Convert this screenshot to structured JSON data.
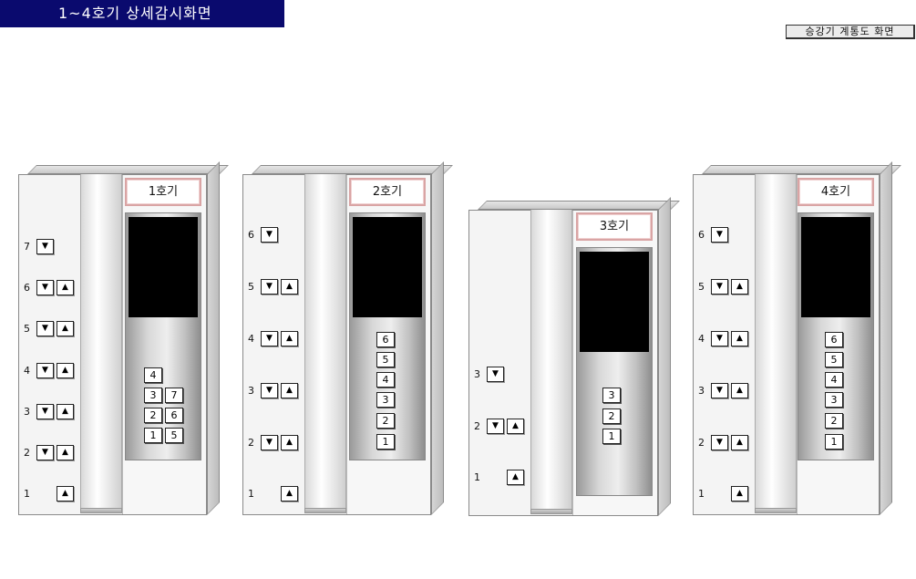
{
  "header": {
    "title": "1~4호기 상세감시화면"
  },
  "toolbar": {
    "system_view_label": "승강기 계통도 화면"
  },
  "icons": {
    "up": "up-triangle-icon",
    "down": "down-triangle-icon"
  },
  "elevators": [
    {
      "label": "1호기",
      "floors": [
        {
          "num": "7",
          "down": true,
          "up": false
        },
        {
          "num": "6",
          "down": true,
          "up": true
        },
        {
          "num": "5",
          "down": true,
          "up": true
        },
        {
          "num": "4",
          "down": true,
          "up": true
        },
        {
          "num": "3",
          "down": true,
          "up": true
        },
        {
          "num": "2",
          "down": true,
          "up": true
        },
        {
          "num": "1",
          "down": false,
          "up": true
        }
      ],
      "car_buttons": [
        "4",
        "3",
        "7",
        "2",
        "6",
        "1",
        "5"
      ]
    },
    {
      "label": "2호기",
      "floors": [
        {
          "num": "6",
          "down": true,
          "up": false
        },
        {
          "num": "5",
          "down": true,
          "up": true
        },
        {
          "num": "4",
          "down": true,
          "up": true
        },
        {
          "num": "3",
          "down": true,
          "up": true
        },
        {
          "num": "2",
          "down": true,
          "up": true
        },
        {
          "num": "1",
          "down": false,
          "up": true
        }
      ],
      "car_buttons": [
        "6",
        "5",
        "4",
        "3",
        "2",
        "1"
      ]
    },
    {
      "label": "3호기",
      "floors": [
        {
          "num": "3",
          "down": true,
          "up": false
        },
        {
          "num": "2",
          "down": true,
          "up": true
        },
        {
          "num": "1",
          "down": false,
          "up": true
        }
      ],
      "car_buttons": [
        "3",
        "2",
        "1"
      ]
    },
    {
      "label": "4호기",
      "floors": [
        {
          "num": "6",
          "down": true,
          "up": false
        },
        {
          "num": "5",
          "down": true,
          "up": true
        },
        {
          "num": "4",
          "down": true,
          "up": true
        },
        {
          "num": "3",
          "down": true,
          "up": true
        },
        {
          "num": "2",
          "down": true,
          "up": true
        },
        {
          "num": "1",
          "down": false,
          "up": true
        }
      ],
      "car_buttons": [
        "6",
        "5",
        "4",
        "3",
        "2",
        "1"
      ]
    }
  ]
}
